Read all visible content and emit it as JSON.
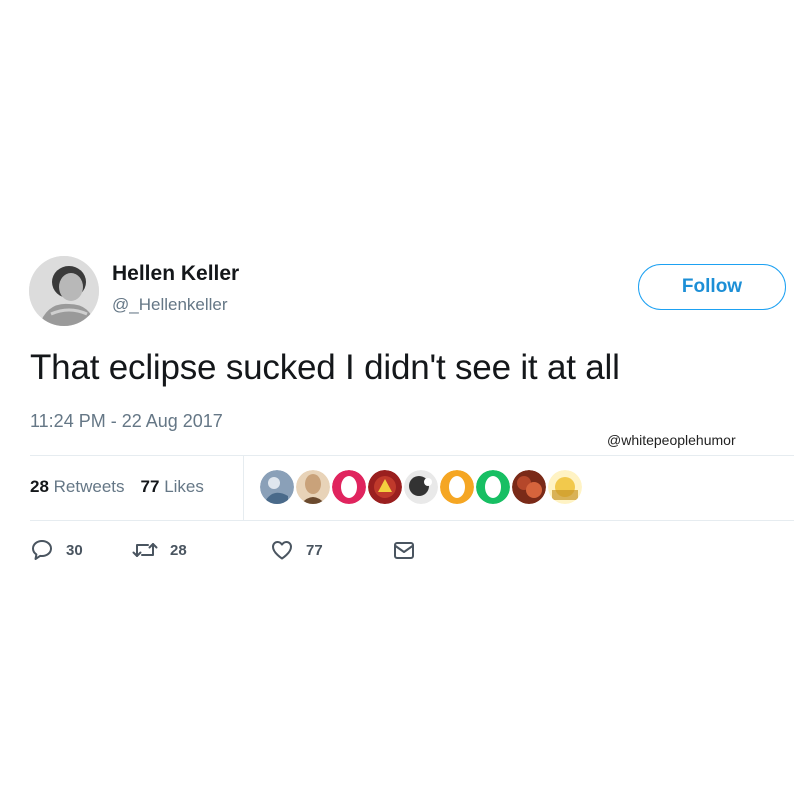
{
  "author": {
    "display_name": "Hellen Keller",
    "handle": "@_Hellenkeller",
    "avatar_icon": "portrait-avatar"
  },
  "follow_button": {
    "label": "Follow",
    "color": "#1da1f2"
  },
  "tweet": {
    "text": "That eclipse sucked I didn't see it at all",
    "timestamp": "11:24 PM - 22 Aug 2017"
  },
  "watermark": "@whitepeoplehumor",
  "stats": {
    "retweets_count": "28",
    "retweets_label": "Retweets",
    "likes_count": "77",
    "likes_label": "Likes"
  },
  "likers": [
    {
      "icon": "liker-avatar-1",
      "color": "#8aa0b8"
    },
    {
      "icon": "liker-avatar-2",
      "color": "#c9a27a"
    },
    {
      "icon": "liker-avatar-3",
      "color": "#e0245e"
    },
    {
      "icon": "liker-avatar-4",
      "color": "#c0392b"
    },
    {
      "icon": "liker-avatar-5",
      "color": "#333333"
    },
    {
      "icon": "liker-avatar-6",
      "color": "#f5a623"
    },
    {
      "icon": "liker-avatar-7",
      "color": "#17bf63"
    },
    {
      "icon": "liker-avatar-8",
      "color": "#b5472a"
    },
    {
      "icon": "liker-avatar-9",
      "color": "#f2c94c"
    }
  ],
  "actions": {
    "reply_count": "30",
    "retweet_count": "28",
    "like_count": "77"
  }
}
